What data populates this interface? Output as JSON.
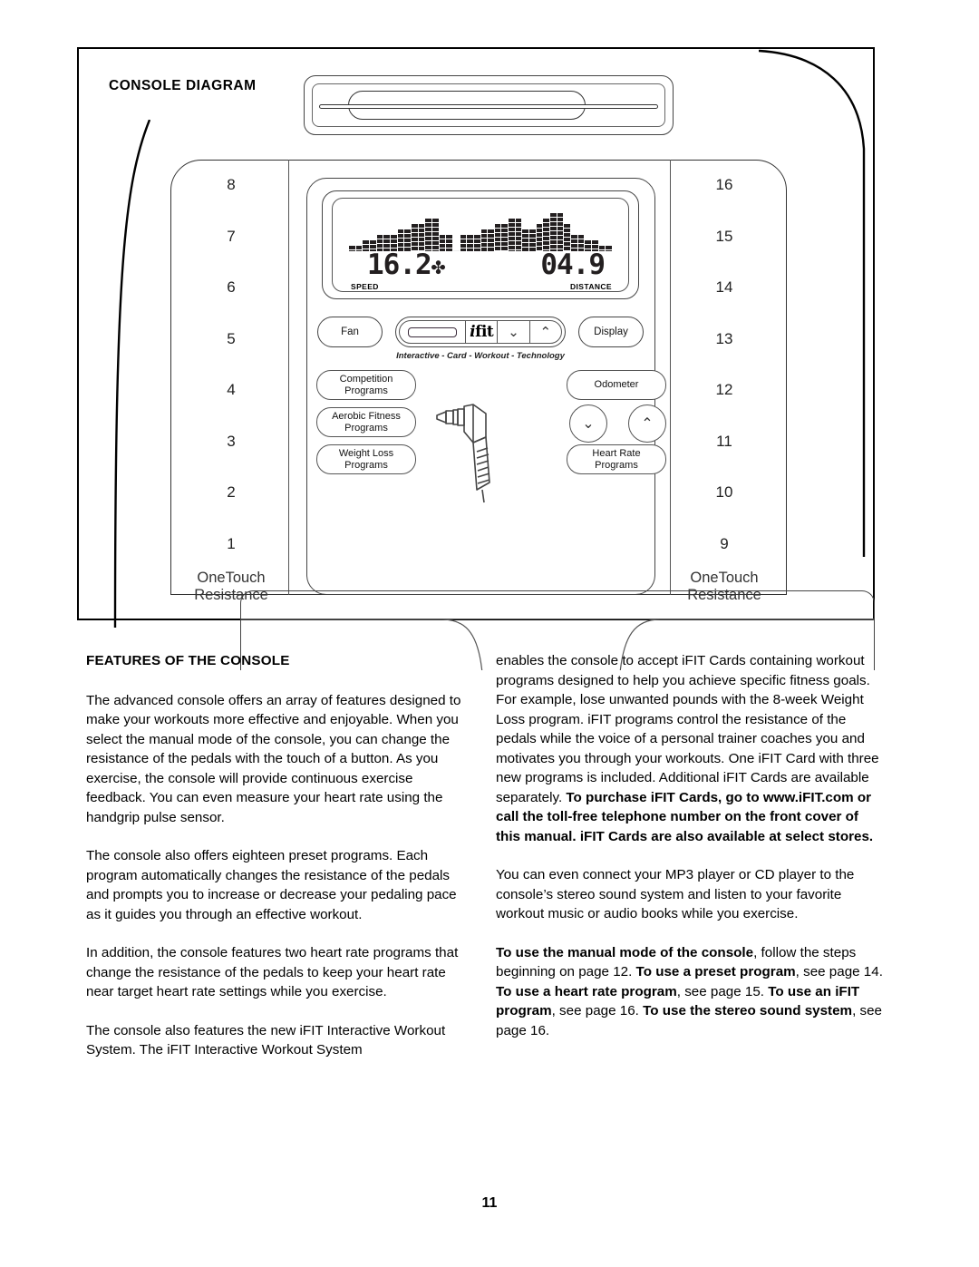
{
  "diagram": {
    "title": "CONSOLE DIAGRAM",
    "left_numbers": [
      "8",
      "7",
      "6",
      "5",
      "4",
      "3",
      "2",
      "1"
    ],
    "right_numbers": [
      "16",
      "15",
      "14",
      "13",
      "12",
      "11",
      "10",
      "9"
    ],
    "onetouch_label_left": "OneTouch\nResistance",
    "onetouch_label_right": "OneTouch\nResistance",
    "display": {
      "speed_value": "16.2",
      "speed_suffix": "✤",
      "speed_label": "SPEED",
      "distance_value": "04.9",
      "distance_label": "DISTANCE"
    },
    "pill_row": {
      "fan_label": "Fan",
      "display_label": "Display",
      "ifit_logo": "fit",
      "ifit_logo_mark": "i",
      "decrease_glyph": "⌄",
      "increase_glyph": "⌃",
      "tagline": "Interactive - Card - Workout - Technology"
    },
    "buttons": {
      "competition": [
        "Competition",
        "Programs"
      ],
      "aerobic": [
        "Aerobic Fitness",
        "Programs"
      ],
      "weightloss": [
        "Weight Loss",
        "Programs"
      ],
      "odometer": [
        "Odometer"
      ],
      "heartrate": [
        "Heart Rate",
        "Programs"
      ],
      "decrease_glyph": "⌄",
      "increase_glyph": "⌃"
    }
  },
  "chart_data": {
    "type": "bar",
    "title": "Console LCD workout profile",
    "xlabel": "",
    "ylabel": "",
    "grid": false,
    "legend": "none",
    "ylim": [
      0,
      8
    ],
    "categories": [
      "1",
      "2",
      "3",
      "4",
      "5",
      "6",
      "7",
      "8",
      "9",
      "10",
      "11",
      "12",
      "13",
      "14",
      "15",
      "16",
      "17",
      "18",
      "19",
      "20",
      "21",
      "22",
      "23",
      "24",
      "25",
      "26",
      "27",
      "28",
      "29",
      "30",
      "31",
      "32",
      "33",
      "34",
      "35",
      "36",
      "37",
      "38"
    ],
    "values": [
      1,
      1,
      2,
      2,
      3,
      3,
      3,
      4,
      4,
      5,
      5,
      6,
      6,
      3,
      3,
      0,
      3,
      3,
      3,
      4,
      4,
      5,
      5,
      6,
      6,
      4,
      4,
      5,
      6,
      7,
      7,
      5,
      3,
      3,
      2,
      2,
      1,
      1
    ],
    "off_indices": [
      15
    ]
  },
  "content": {
    "section_title": "FEATURES OF THE CONSOLE",
    "left_paragraphs": [
      "The advanced console offers an array of features designed to make your workouts more effective and enjoyable. When you select the manual mode of the console, you can change the resistance of the pedals with the touch of a button. As you exercise, the console will provide continuous exercise feedback. You can even measure your heart rate using the handgrip pulse sensor.",
      "The console also offers eighteen preset programs. Each program automatically changes the resistance of the pedals and prompts you to increase or decrease your pedaling pace as it guides you through an effective workout.",
      "In addition, the console features two heart rate programs that change the resistance of the pedals to keep your heart rate near target heart rate settings while you exercise.",
      "The console also features the new iFIT Interactive Workout System. The iFIT Interactive Workout System"
    ],
    "right_paragraph_1_plain": "enables the console to accept iFIT Cards containing workout programs designed to help you achieve specific fitness goals. For example, lose unwanted pounds with the 8-week Weight Loss program. iFIT programs control the resistance of the pedals while the voice of a personal trainer coaches you and motivates you through your workouts. One iFIT Card with three new programs is included. Additional iFIT Cards are available separately. ",
    "right_paragraph_1_bold": "To purchase iFIT Cards, go to www.iFIT.com or call the toll-free telephone number on the front cover of this manual. iFIT Cards are also available at select stores.",
    "right_paragraph_2": "You can even connect your MP3 player or CD player to the console’s stereo sound system and listen to your favorite workout music or audio books while you exercise.",
    "right_paragraph_3": {
      "b1": "To use the manual mode of the console",
      "t1": ", follow the steps beginning on page 12. ",
      "b2": "To use a preset program",
      "t2": ", see page 14. ",
      "b3": "To use a heart rate program",
      "t3": ", see page 15. ",
      "b4": "To use an iFIT program",
      "t4": ", see page 16. ",
      "b5": "To use the stereo sound system",
      "t5": ", see page 16."
    }
  },
  "page_number": "11"
}
